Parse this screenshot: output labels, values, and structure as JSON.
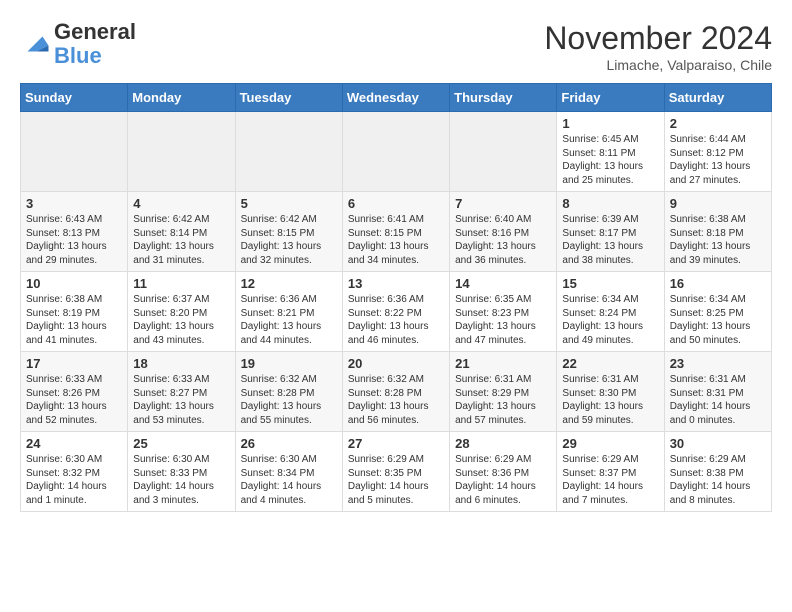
{
  "header": {
    "logo_general": "General",
    "logo_blue": "Blue",
    "month_title": "November 2024",
    "location": "Limache, Valparaiso, Chile"
  },
  "weekdays": [
    "Sunday",
    "Monday",
    "Tuesday",
    "Wednesday",
    "Thursday",
    "Friday",
    "Saturday"
  ],
  "weeks": [
    [
      {
        "day": "",
        "info": ""
      },
      {
        "day": "",
        "info": ""
      },
      {
        "day": "",
        "info": ""
      },
      {
        "day": "",
        "info": ""
      },
      {
        "day": "",
        "info": ""
      },
      {
        "day": "1",
        "info": "Sunrise: 6:45 AM\nSunset: 8:11 PM\nDaylight: 13 hours and 25 minutes."
      },
      {
        "day": "2",
        "info": "Sunrise: 6:44 AM\nSunset: 8:12 PM\nDaylight: 13 hours and 27 minutes."
      }
    ],
    [
      {
        "day": "3",
        "info": "Sunrise: 6:43 AM\nSunset: 8:13 PM\nDaylight: 13 hours and 29 minutes."
      },
      {
        "day": "4",
        "info": "Sunrise: 6:42 AM\nSunset: 8:14 PM\nDaylight: 13 hours and 31 minutes."
      },
      {
        "day": "5",
        "info": "Sunrise: 6:42 AM\nSunset: 8:15 PM\nDaylight: 13 hours and 32 minutes."
      },
      {
        "day": "6",
        "info": "Sunrise: 6:41 AM\nSunset: 8:15 PM\nDaylight: 13 hours and 34 minutes."
      },
      {
        "day": "7",
        "info": "Sunrise: 6:40 AM\nSunset: 8:16 PM\nDaylight: 13 hours and 36 minutes."
      },
      {
        "day": "8",
        "info": "Sunrise: 6:39 AM\nSunset: 8:17 PM\nDaylight: 13 hours and 38 minutes."
      },
      {
        "day": "9",
        "info": "Sunrise: 6:38 AM\nSunset: 8:18 PM\nDaylight: 13 hours and 39 minutes."
      }
    ],
    [
      {
        "day": "10",
        "info": "Sunrise: 6:38 AM\nSunset: 8:19 PM\nDaylight: 13 hours and 41 minutes."
      },
      {
        "day": "11",
        "info": "Sunrise: 6:37 AM\nSunset: 8:20 PM\nDaylight: 13 hours and 43 minutes."
      },
      {
        "day": "12",
        "info": "Sunrise: 6:36 AM\nSunset: 8:21 PM\nDaylight: 13 hours and 44 minutes."
      },
      {
        "day": "13",
        "info": "Sunrise: 6:36 AM\nSunset: 8:22 PM\nDaylight: 13 hours and 46 minutes."
      },
      {
        "day": "14",
        "info": "Sunrise: 6:35 AM\nSunset: 8:23 PM\nDaylight: 13 hours and 47 minutes."
      },
      {
        "day": "15",
        "info": "Sunrise: 6:34 AM\nSunset: 8:24 PM\nDaylight: 13 hours and 49 minutes."
      },
      {
        "day": "16",
        "info": "Sunrise: 6:34 AM\nSunset: 8:25 PM\nDaylight: 13 hours and 50 minutes."
      }
    ],
    [
      {
        "day": "17",
        "info": "Sunrise: 6:33 AM\nSunset: 8:26 PM\nDaylight: 13 hours and 52 minutes."
      },
      {
        "day": "18",
        "info": "Sunrise: 6:33 AM\nSunset: 8:27 PM\nDaylight: 13 hours and 53 minutes."
      },
      {
        "day": "19",
        "info": "Sunrise: 6:32 AM\nSunset: 8:28 PM\nDaylight: 13 hours and 55 minutes."
      },
      {
        "day": "20",
        "info": "Sunrise: 6:32 AM\nSunset: 8:28 PM\nDaylight: 13 hours and 56 minutes."
      },
      {
        "day": "21",
        "info": "Sunrise: 6:31 AM\nSunset: 8:29 PM\nDaylight: 13 hours and 57 minutes."
      },
      {
        "day": "22",
        "info": "Sunrise: 6:31 AM\nSunset: 8:30 PM\nDaylight: 13 hours and 59 minutes."
      },
      {
        "day": "23",
        "info": "Sunrise: 6:31 AM\nSunset: 8:31 PM\nDaylight: 14 hours and 0 minutes."
      }
    ],
    [
      {
        "day": "24",
        "info": "Sunrise: 6:30 AM\nSunset: 8:32 PM\nDaylight: 14 hours and 1 minute."
      },
      {
        "day": "25",
        "info": "Sunrise: 6:30 AM\nSunset: 8:33 PM\nDaylight: 14 hours and 3 minutes."
      },
      {
        "day": "26",
        "info": "Sunrise: 6:30 AM\nSunset: 8:34 PM\nDaylight: 14 hours and 4 minutes."
      },
      {
        "day": "27",
        "info": "Sunrise: 6:29 AM\nSunset: 8:35 PM\nDaylight: 14 hours and 5 minutes."
      },
      {
        "day": "28",
        "info": "Sunrise: 6:29 AM\nSunset: 8:36 PM\nDaylight: 14 hours and 6 minutes."
      },
      {
        "day": "29",
        "info": "Sunrise: 6:29 AM\nSunset: 8:37 PM\nDaylight: 14 hours and 7 minutes."
      },
      {
        "day": "30",
        "info": "Sunrise: 6:29 AM\nSunset: 8:38 PM\nDaylight: 14 hours and 8 minutes."
      }
    ]
  ]
}
